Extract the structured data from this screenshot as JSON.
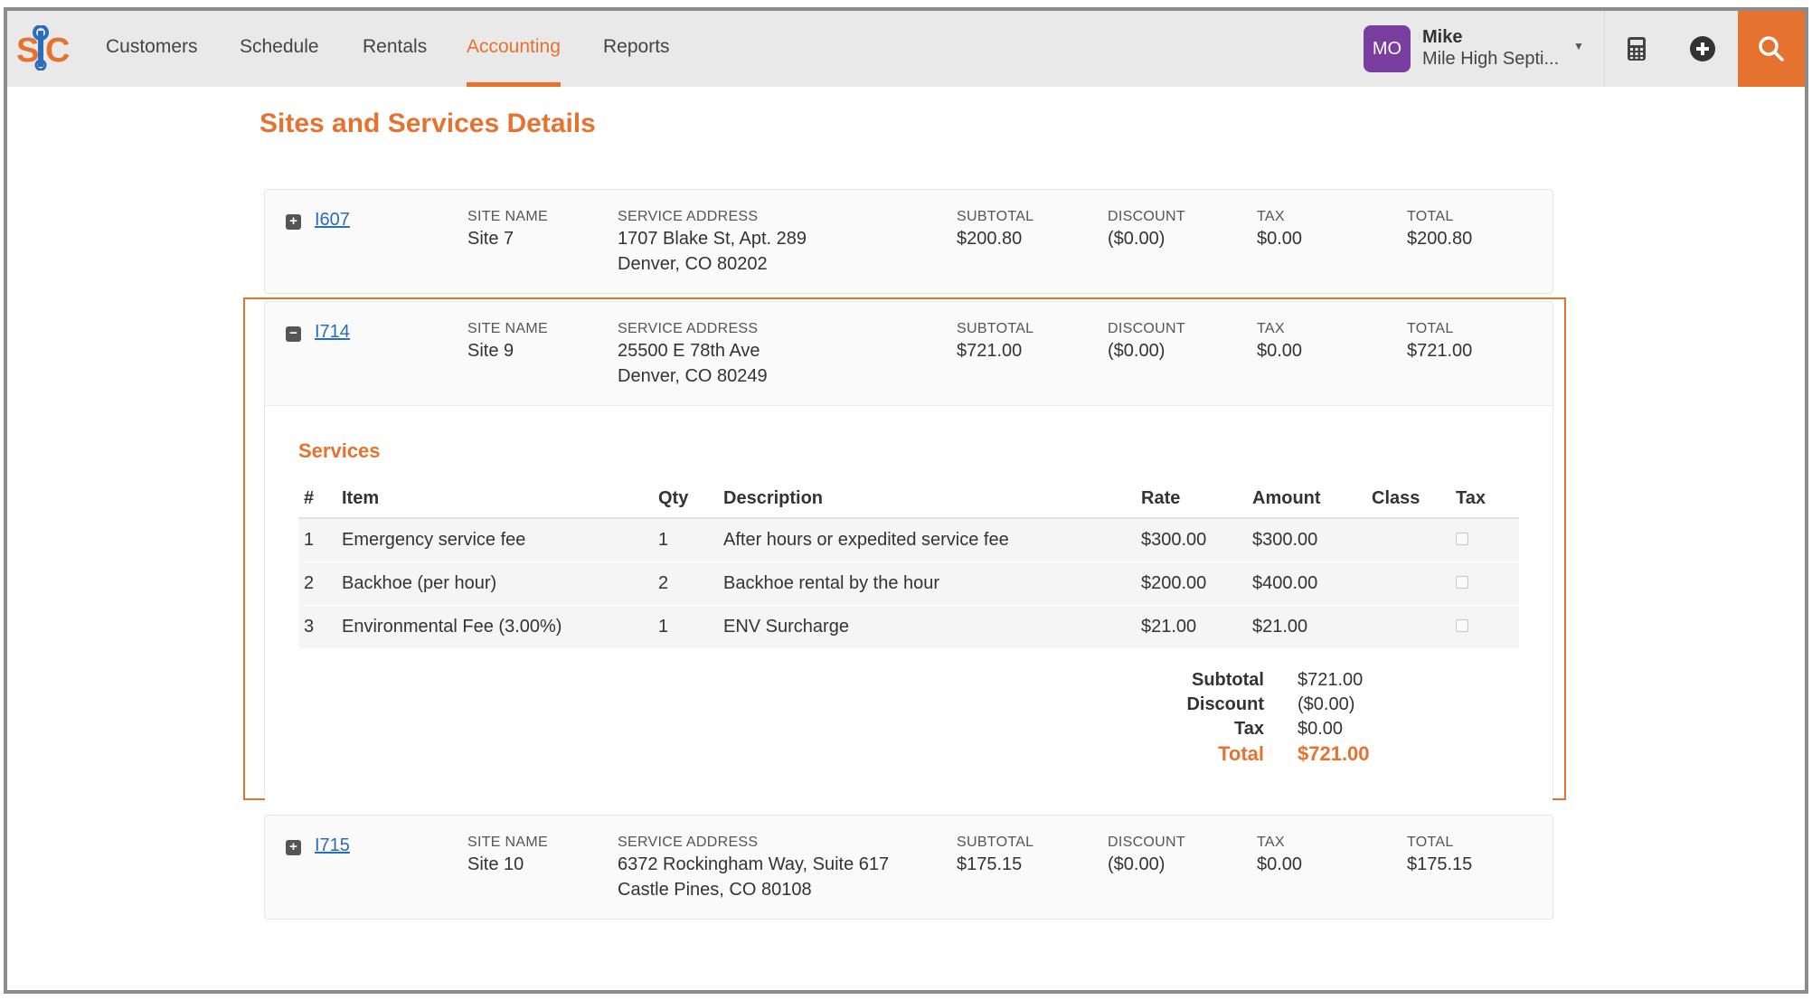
{
  "nav": {
    "logo_text": "S|C",
    "items": [
      {
        "label": "Customers",
        "active": false
      },
      {
        "label": "Schedule",
        "active": false
      },
      {
        "label": "Rentals",
        "active": false
      },
      {
        "label": "Accounting",
        "active": true
      },
      {
        "label": "Reports",
        "active": false
      }
    ],
    "user": {
      "initials": "MO",
      "name": "Mike",
      "company": "Mile High Septi..."
    },
    "icons": [
      "calculator-icon",
      "plus-circle-icon",
      "search-icon"
    ]
  },
  "page": {
    "title": "Sites and Services Details"
  },
  "labels": {
    "site_name": "SITE NAME",
    "service_address": "SERVICE ADDRESS",
    "subtotal": "SUBTOTAL",
    "discount": "DISCOUNT",
    "tax": "TAX",
    "total": "TOTAL"
  },
  "sites": [
    {
      "invoice": "I607",
      "expanded": false,
      "site_name": "Site 7",
      "address_line1": "1707 Blake St, Apt. 289",
      "address_line2": "Denver, CO 80202",
      "subtotal": "$200.80",
      "discount": "($0.00)",
      "tax": "$0.00",
      "total": "$200.80"
    },
    {
      "invoice": "I714",
      "expanded": true,
      "site_name": "Site 9",
      "address_line1": "25500 E 78th Ave",
      "address_line2": "Denver, CO 80249",
      "subtotal": "$721.00",
      "discount": "($0.00)",
      "tax": "$0.00",
      "total": "$721.00",
      "services": {
        "title": "Services",
        "columns": [
          "#",
          "Item",
          "Qty",
          "Description",
          "Rate",
          "Amount",
          "Class",
          "Tax"
        ],
        "rows": [
          {
            "num": "1",
            "item": "Emergency service fee",
            "qty": "1",
            "description": "After hours or expedited service fee",
            "rate": "$300.00",
            "amount": "$300.00",
            "class": "",
            "tax": false
          },
          {
            "num": "2",
            "item": "Backhoe (per hour)",
            "qty": "2",
            "description": "Backhoe rental by the hour",
            "rate": "$200.00",
            "amount": "$400.00",
            "class": "",
            "tax": false
          },
          {
            "num": "3",
            "item": "Environmental Fee (3.00%)",
            "qty": "1",
            "description": "ENV Surcharge",
            "rate": "$21.00",
            "amount": "$21.00",
            "class": "",
            "tax": false
          }
        ],
        "totals": {
          "subtotal_label": "Subtotal",
          "subtotal": "$721.00",
          "discount_label": "Discount",
          "discount": "($0.00)",
          "tax_label": "Tax",
          "tax": "$0.00",
          "total_label": "Total",
          "total": "$721.00"
        }
      }
    },
    {
      "invoice": "I715",
      "expanded": false,
      "site_name": "Site 10",
      "address_line1": "6372 Rockingham Way, Suite 617",
      "address_line2": "Castle Pines, CO 80108",
      "subtotal": "$175.15",
      "discount": "($0.00)",
      "tax": "$0.00",
      "total": "$175.15"
    }
  ],
  "colors": {
    "accent": "#e5732f",
    "avatar": "#7a3ea1",
    "link": "#2a6db8"
  }
}
